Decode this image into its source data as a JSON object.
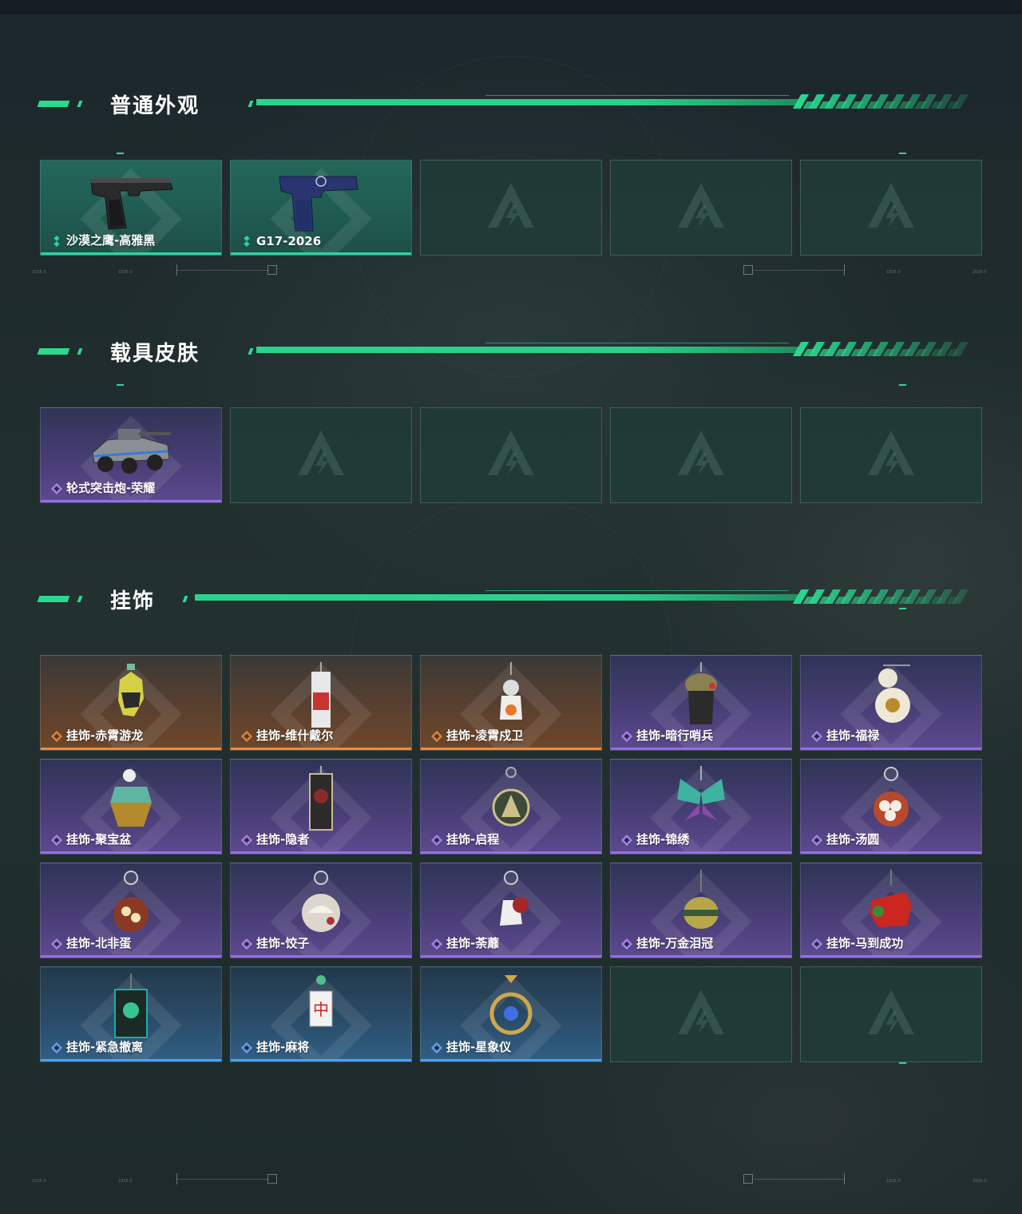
{
  "sections": [
    {
      "title": "普通外观",
      "items": [
        {
          "label": "沙漠之鹰-高雅黑",
          "rarity": "green",
          "icon": "desert-eagle-pistol-icon"
        },
        {
          "label": "G17-2026",
          "rarity": "green",
          "icon": "g17-pistol-icon"
        },
        {
          "label": "",
          "rarity": "empty"
        },
        {
          "label": "",
          "rarity": "empty"
        },
        {
          "label": "",
          "rarity": "empty"
        }
      ]
    },
    {
      "title": "载具皮肤",
      "items": [
        {
          "label": "轮式突击炮-荣耀",
          "rarity": "purple",
          "icon": "wheeled-assault-vehicle-icon"
        },
        {
          "label": "",
          "rarity": "empty"
        },
        {
          "label": "",
          "rarity": "empty"
        },
        {
          "label": "",
          "rarity": "empty"
        },
        {
          "label": "",
          "rarity": "empty"
        }
      ]
    },
    {
      "title": "挂饰",
      "items": [
        {
          "label": "挂饰-赤霄游龙",
          "rarity": "orange",
          "icon": "dragon-charm-icon"
        },
        {
          "label": "挂饰-维什戴尔",
          "rarity": "orange",
          "icon": "card-charm-icon"
        },
        {
          "label": "挂饰-凌霄戍卫",
          "rarity": "orange",
          "icon": "guardian-charm-icon"
        },
        {
          "label": "挂饰-暗行哨兵",
          "rarity": "purple",
          "icon": "sentry-charm-icon"
        },
        {
          "label": "挂饰-福禄",
          "rarity": "purple",
          "icon": "gourd-charm-icon"
        },
        {
          "label": "挂饰-聚宝盆",
          "rarity": "purple",
          "icon": "treasure-bowl-charm-icon"
        },
        {
          "label": "挂饰-隐者",
          "rarity": "purple",
          "icon": "hermit-card-charm-icon"
        },
        {
          "label": "挂饰-启程",
          "rarity": "purple",
          "icon": "emblem-charm-icon"
        },
        {
          "label": "挂饰-锦绣",
          "rarity": "purple",
          "icon": "butterfly-charm-icon"
        },
        {
          "label": "挂饰-汤圆",
          "rarity": "purple",
          "icon": "tangyuan-charm-icon"
        },
        {
          "label": "挂饰-北非蛋",
          "rarity": "purple",
          "icon": "shakshuka-charm-icon"
        },
        {
          "label": "挂饰-饺子",
          "rarity": "purple",
          "icon": "dumpling-charm-icon"
        },
        {
          "label": "挂饰-荼蘼",
          "rarity": "purple",
          "icon": "flower-charm-icon"
        },
        {
          "label": "挂饰-万金泪冠",
          "rarity": "purple",
          "icon": "crown-charm-icon"
        },
        {
          "label": "挂饰-马到成功",
          "rarity": "purple",
          "icon": "horse-charm-icon"
        },
        {
          "label": "挂饰-紧急撤离",
          "rarity": "blue",
          "icon": "evac-sign-charm-icon"
        },
        {
          "label": "挂饰-麻将",
          "rarity": "blue",
          "icon": "mahjong-charm-icon"
        },
        {
          "label": "挂饰-星象仪",
          "rarity": "blue",
          "icon": "astrolabe-charm-icon"
        },
        {
          "label": "",
          "rarity": "empty"
        },
        {
          "label": "",
          "rarity": "empty"
        }
      ]
    }
  ],
  "colors": {
    "accent": "#2bd98f",
    "rarity_green": "#2bd3a0",
    "rarity_purple": "#9c6ce6",
    "rarity_orange": "#f08a3c",
    "rarity_blue": "#4da3f0"
  }
}
